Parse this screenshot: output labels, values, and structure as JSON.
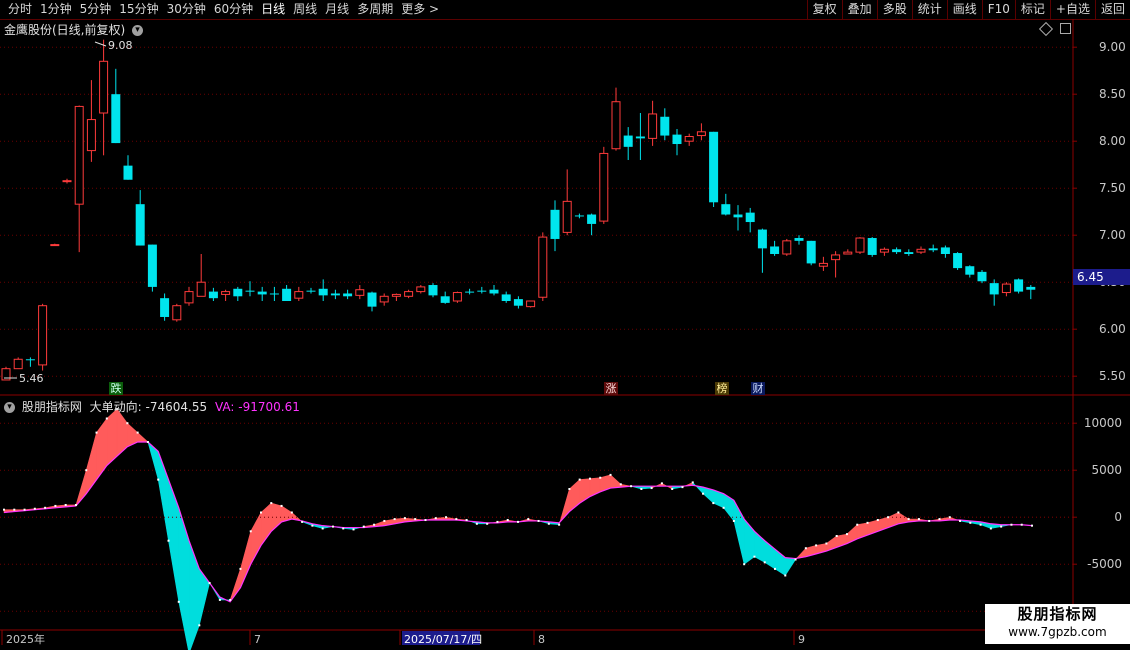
{
  "toolbar": {
    "left": [
      "分时",
      "1分钟",
      "5分钟",
      "15分钟",
      "30分钟",
      "60分钟",
      "日线",
      "周线",
      "月线",
      "多周期",
      "更多 >"
    ],
    "active": "日线",
    "right": [
      "复权",
      "叠加",
      "多股",
      "统计",
      "画线",
      "F10",
      "标记",
      "+自选",
      "返回"
    ]
  },
  "stock": {
    "title": "金鹰股份(日线,前复权)",
    "current_price": "6.45",
    "high_label": "9.08",
    "low_label": "5.46"
  },
  "indicator": {
    "title": "股朋指标网",
    "main_label": "大单动向: -74604.55",
    "va_label": "VA: -91700.61"
  },
  "badges": [
    "跌",
    "涨",
    "榜",
    "财"
  ],
  "timeline": {
    "labels": [
      "2025年",
      "7",
      "2025/07/17/四",
      "8",
      "9"
    ]
  },
  "watermark": {
    "title": "股朋指标网",
    "url": "www.7gpzb.com"
  },
  "colors": {
    "up": "#ff3b3b",
    "down": "#00e5ee",
    "axis": "#8b0000",
    "grid": "#6a0000",
    "indicator_up": "#ff5b5b",
    "indicator_down": "#00dddd",
    "va": "#ff33ff"
  },
  "chart_data": [
    {
      "type": "candlestick",
      "title": "金鹰股份(日线,前复权)",
      "ylim": [
        5.3,
        9.3
      ],
      "yticks": [
        "9.00",
        "8.50",
        "8.00",
        "7.50",
        "7.00",
        "6.50",
        "6.00",
        "5.50"
      ],
      "ohlc": [
        [
          5.46,
          5.6,
          5.58,
          5.46
        ],
        [
          5.58,
          5.7,
          5.68,
          5.58
        ],
        [
          5.68,
          5.7,
          5.67,
          5.6
        ],
        [
          5.62,
          6.27,
          6.25,
          5.56
        ],
        [
          6.9,
          6.91,
          6.9,
          6.89
        ],
        [
          7.58,
          7.6,
          7.58,
          7.55
        ],
        [
          7.33,
          8.38,
          8.37,
          6.82
        ],
        [
          7.9,
          8.65,
          8.23,
          7.78
        ],
        [
          8.3,
          9.08,
          8.85,
          7.85
        ],
        [
          8.5,
          8.77,
          7.98,
          7.98
        ],
        [
          7.74,
          7.85,
          7.59,
          7.59
        ],
        [
          7.33,
          7.48,
          6.89,
          6.89
        ],
        [
          6.9,
          6.9,
          6.45,
          6.4
        ],
        [
          6.33,
          6.38,
          6.13,
          6.09
        ],
        [
          6.1,
          6.27,
          6.25,
          6.08
        ],
        [
          6.28,
          6.45,
          6.4,
          6.25
        ],
        [
          6.35,
          6.8,
          6.5,
          6.35
        ],
        [
          6.4,
          6.44,
          6.33,
          6.3
        ],
        [
          6.37,
          6.42,
          6.4,
          6.3
        ],
        [
          6.43,
          6.45,
          6.35,
          6.3
        ],
        [
          6.41,
          6.51,
          6.4,
          6.35
        ],
        [
          6.4,
          6.45,
          6.37,
          6.3
        ],
        [
          6.38,
          6.45,
          6.37,
          6.3
        ],
        [
          6.43,
          6.47,
          6.3,
          6.3
        ],
        [
          6.33,
          6.45,
          6.4,
          6.3
        ],
        [
          6.41,
          6.44,
          6.4,
          6.38
        ],
        [
          6.43,
          6.53,
          6.36,
          6.3
        ],
        [
          6.38,
          6.42,
          6.36,
          6.32
        ],
        [
          6.38,
          6.42,
          6.35,
          6.32
        ],
        [
          6.36,
          6.47,
          6.42,
          6.32
        ],
        [
          6.39,
          6.4,
          6.24,
          6.19
        ],
        [
          6.29,
          6.38,
          6.35,
          6.25
        ],
        [
          6.35,
          6.38,
          6.37,
          6.3
        ],
        [
          6.35,
          6.42,
          6.4,
          6.33
        ],
        [
          6.4,
          6.47,
          6.45,
          6.38
        ],
        [
          6.47,
          6.49,
          6.36,
          6.34
        ],
        [
          6.35,
          6.4,
          6.28,
          6.27
        ],
        [
          6.3,
          6.4,
          6.39,
          6.28
        ],
        [
          6.4,
          6.43,
          6.39,
          6.37
        ],
        [
          6.41,
          6.45,
          6.4,
          6.38
        ],
        [
          6.42,
          6.47,
          6.38,
          6.36
        ],
        [
          6.37,
          6.4,
          6.3,
          6.28
        ],
        [
          6.32,
          6.35,
          6.25,
          6.22
        ],
        [
          6.24,
          6.3,
          6.3,
          6.23
        ],
        [
          6.34,
          7.03,
          6.98,
          6.3
        ],
        [
          7.27,
          7.37,
          6.96,
          6.83
        ],
        [
          7.03,
          7.7,
          7.36,
          7.0
        ],
        [
          7.21,
          7.23,
          7.2,
          7.18
        ],
        [
          7.22,
          7.23,
          7.12,
          7.0
        ],
        [
          7.15,
          7.94,
          7.87,
          7.12
        ],
        [
          7.92,
          8.57,
          8.42,
          7.9
        ],
        [
          8.06,
          8.15,
          7.94,
          7.8
        ],
        [
          8.05,
          8.3,
          8.03,
          7.8
        ],
        [
          8.03,
          8.43,
          8.29,
          7.95
        ],
        [
          8.26,
          8.35,
          8.06,
          8.01
        ],
        [
          8.07,
          8.13,
          7.97,
          7.85
        ],
        [
          8.0,
          8.08,
          8.05,
          7.95
        ],
        [
          8.06,
          8.19,
          8.1,
          8.01
        ],
        [
          8.1,
          8.1,
          7.35,
          7.3
        ],
        [
          7.33,
          7.44,
          7.22,
          7.21
        ],
        [
          7.22,
          7.32,
          7.19,
          7.05
        ],
        [
          7.24,
          7.29,
          7.14,
          7.03
        ],
        [
          7.06,
          7.07,
          6.86,
          6.6
        ],
        [
          6.88,
          6.94,
          6.8,
          6.78
        ],
        [
          6.8,
          6.96,
          6.94,
          6.78
        ],
        [
          6.97,
          7.0,
          6.94,
          6.9
        ],
        [
          6.94,
          6.94,
          6.7,
          6.68
        ],
        [
          6.67,
          6.77,
          6.7,
          6.62
        ],
        [
          6.74,
          6.83,
          6.79,
          6.55
        ],
        [
          6.8,
          6.85,
          6.82,
          6.8
        ],
        [
          6.82,
          6.98,
          6.97,
          6.8
        ],
        [
          6.97,
          6.98,
          6.79,
          6.77
        ],
        [
          6.82,
          6.87,
          6.85,
          6.78
        ],
        [
          6.85,
          6.87,
          6.82,
          6.8
        ],
        [
          6.82,
          6.85,
          6.8,
          6.78
        ],
        [
          6.82,
          6.88,
          6.85,
          6.8
        ],
        [
          6.86,
          6.9,
          6.84,
          6.82
        ],
        [
          6.87,
          6.89,
          6.8,
          6.76
        ],
        [
          6.81,
          6.82,
          6.65,
          6.63
        ],
        [
          6.67,
          6.68,
          6.58,
          6.55
        ],
        [
          6.61,
          6.63,
          6.51,
          6.49
        ],
        [
          6.49,
          6.53,
          6.37,
          6.25
        ],
        [
          6.39,
          6.5,
          6.48,
          6.35
        ],
        [
          6.53,
          6.54,
          6.4,
          6.38
        ],
        [
          6.45,
          6.47,
          6.42,
          6.32
        ]
      ]
    },
    {
      "type": "area",
      "title": "大单动向",
      "ylim": [
        -12000,
        13000
      ],
      "yticks": [
        "10000",
        "5000",
        "0",
        "-5000",
        "-10000"
      ],
      "series": [
        {
          "name": "大单动向",
          "values": [
            800,
            800,
            800,
            900,
            1000,
            1200,
            1300,
            1300,
            5000,
            9000,
            10500,
            11500,
            10000,
            9000,
            8000,
            4000,
            -2500,
            -9000,
            -14500,
            -11500,
            -7000,
            -8800,
            -8800,
            -5500,
            -1500,
            500,
            1500,
            1200,
            500,
            -500,
            -900,
            -1200,
            -1000,
            -1200,
            -1300,
            -1000,
            -800,
            -400,
            -200,
            -100,
            -200,
            -300,
            -100,
            0,
            -200,
            -300,
            -700,
            -700,
            -500,
            -300,
            -500,
            -200,
            -400,
            -700,
            -800,
            3000,
            4000,
            4100,
            4200,
            4500,
            3500,
            3300,
            3000,
            3100,
            3600,
            3000,
            3200,
            3700,
            2500,
            1500,
            1000,
            -400,
            -5000,
            -4200,
            -4800,
            -5500,
            -6200,
            -4500,
            -3300,
            -3000,
            -2800,
            -2000,
            -1800,
            -800,
            -600,
            -300,
            0,
            500,
            -200,
            -200,
            -400,
            -200,
            0,
            -400,
            -600,
            -800,
            -1200,
            -1000,
            -800,
            -800,
            -900
          ]
        },
        {
          "name": "VA",
          "values": [
            500,
            600,
            700,
            800,
            900,
            1000,
            1100,
            1200,
            2500,
            4000,
            5500,
            6500,
            7500,
            8000,
            8000,
            7000,
            4000,
            1000,
            -2500,
            -5500,
            -7000,
            -8500,
            -9000,
            -7500,
            -5000,
            -3000,
            -1500,
            -500,
            -200,
            -400,
            -700,
            -900,
            -1000,
            -1100,
            -1100,
            -1100,
            -1000,
            -900,
            -700,
            -500,
            -400,
            -300,
            -300,
            -300,
            -300,
            -400,
            -500,
            -600,
            -600,
            -500,
            -500,
            -400,
            -400,
            -500,
            -600,
            600,
            1500,
            2200,
            2700,
            3100,
            3200,
            3300,
            3300,
            3300,
            3300,
            3300,
            3300,
            3400,
            3200,
            2900,
            2500,
            1800,
            -200,
            -1500,
            -2500,
            -3400,
            -4300,
            -4400,
            -4200,
            -3900,
            -3600,
            -3200,
            -2800,
            -2300,
            -1900,
            -1500,
            -1100,
            -700,
            -500,
            -400,
            -400,
            -400,
            -300,
            -300,
            -400,
            -500,
            -700,
            -800,
            -800,
            -800,
            -900
          ]
        }
      ]
    }
  ]
}
